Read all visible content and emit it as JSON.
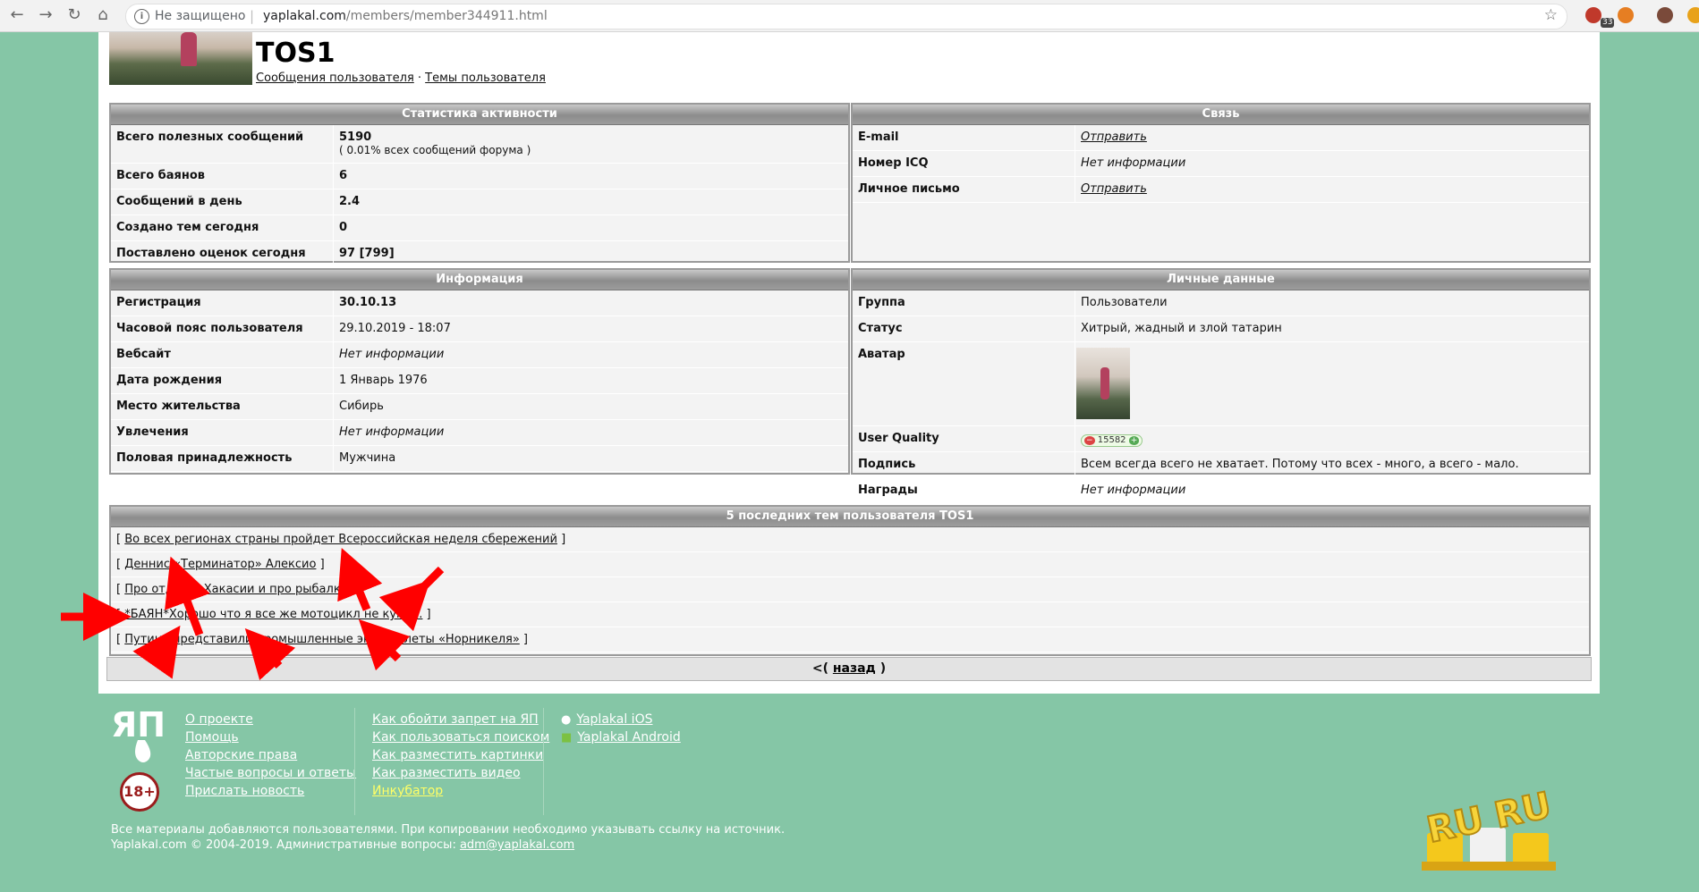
{
  "browser": {
    "security_label": "Не защищено",
    "url_domain": "yaplakal.com",
    "url_path": "/members/member344911.html",
    "ext_badge": "33"
  },
  "profile": {
    "username": "TOS1",
    "link_posts": "Сообщения пользователя",
    "link_sep": " · ",
    "link_topics": "Темы пользователя"
  },
  "stats": {
    "title": "Статистика активности",
    "rows": [
      {
        "label": "Всего полезных сообщений",
        "value": "5190",
        "sub": "( 0.01% всех сообщений форума )"
      },
      {
        "label": "Всего баянов",
        "value": "6"
      },
      {
        "label": "Сообщений в день",
        "value": "2.4"
      },
      {
        "label": "Создано тем сегодня",
        "value": "0"
      },
      {
        "label": "Поставлено оценок сегодня",
        "value": "97 [799]"
      }
    ]
  },
  "contact": {
    "title": "Связь",
    "rows": [
      {
        "label": "E-mail",
        "value": "Отправить"
      },
      {
        "label": "Номер ICQ",
        "value": "Нет информации"
      },
      {
        "label": "Личное письмо",
        "value": "Отправить"
      }
    ]
  },
  "info": {
    "title": "Информация",
    "rows": [
      {
        "label": "Регистрация",
        "value": "30.10.13"
      },
      {
        "label": "Часовой пояс пользователя",
        "value": "29.10.2019 - 18:07"
      },
      {
        "label": "Вебсайт",
        "value": "Нет информации"
      },
      {
        "label": "Дата рождения",
        "value": "1 Январь 1976"
      },
      {
        "label": "Место жительства",
        "value": "Сибирь"
      },
      {
        "label": "Увлечения",
        "value": "Нет информации"
      },
      {
        "label": "Половая принадлежность",
        "value": "Мужчина"
      }
    ]
  },
  "personal": {
    "title": "Личные данные",
    "rows": [
      {
        "label": "Группа",
        "value": "Пользователи"
      },
      {
        "label": "Статус",
        "value": "Хитрый, жадный и злой татарин"
      },
      {
        "label": "Аватар",
        "value": ""
      },
      {
        "label": "User Quality",
        "value": "15582"
      },
      {
        "label": "Подпись",
        "value": "Всем всегда всего не хватает. Потому что всех - много, а всего - мало."
      },
      {
        "label": "Награды",
        "value": "Нет информации"
      }
    ]
  },
  "topics": {
    "title": "5 последних тем пользователя TOS1",
    "bracket_open": "[ ",
    "bracket_close": " ]",
    "items": [
      "Во всех регионах страны пройдет Всероссийская неделя сбережений",
      "Деннис «Терминатор» Алексио",
      "Про отдых в Хакасии и про рыбалку",
      "*БАЯН*Хорошо что я все же мотоцикл не купил.",
      "Путину представили промышленные экзоскелеты «Норникеля»"
    ]
  },
  "back": {
    "prefix": "<( ",
    "link": "назад",
    "suffix": " )"
  },
  "footer": {
    "col1": [
      "О проекте",
      "Помощь",
      "Авторские права",
      "Частые вопросы и ответы",
      "Прислать новость"
    ],
    "col2": [
      "Как обойти запрет на ЯП",
      "Как пользоваться поиском",
      "Как разместить картинки",
      "Как разместить видео",
      "Инкубатор"
    ],
    "col3": [
      "Yaplakal iOS",
      "Yaplakal Android"
    ],
    "age": "18+",
    "logo_text": "ЯП",
    "ruru_text": "RU RU",
    "copyright_line1": "Все материалы добавляются пользователями. При копировании необходимо указывать ссылку на источник.",
    "copyright_line2": "Yaplakal.com © 2004-2019. Административные вопросы: ",
    "admin_email": "adm@yaplakal.com"
  },
  "colors": {
    "background": "#85c6a6",
    "panel_header": "#9c9c9c",
    "arrow": "#ff0000",
    "incubator_link": "#ffff66"
  }
}
